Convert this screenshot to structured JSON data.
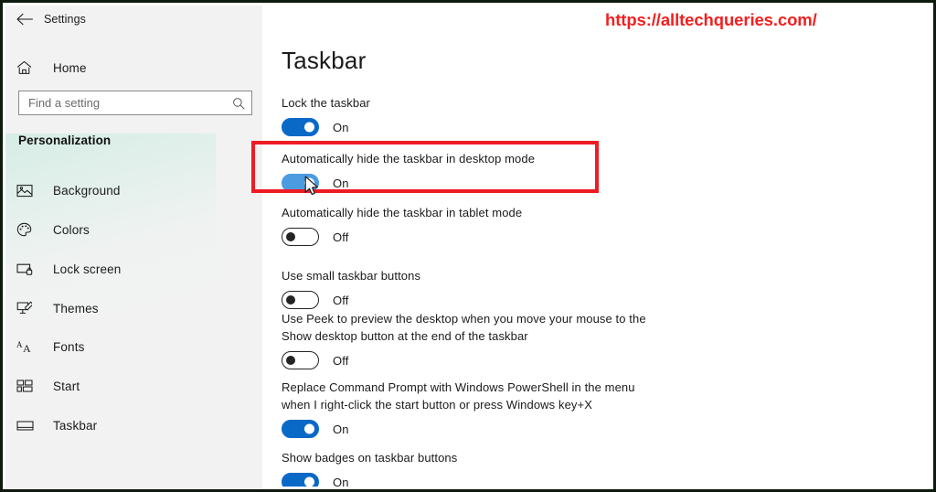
{
  "window": {
    "back_label": "back-arrow",
    "title": "Settings"
  },
  "sidebar": {
    "home": {
      "label": "Home",
      "icon": "home-icon"
    },
    "search": {
      "value": "",
      "placeholder": "Find a setting",
      "icon": "search-icon"
    },
    "section_heading": "Personalization",
    "items": [
      {
        "label": "Background",
        "icon": "image-icon"
      },
      {
        "label": "Colors",
        "icon": "palette-icon"
      },
      {
        "label": "Lock screen",
        "icon": "lock-screen-icon"
      },
      {
        "label": "Themes",
        "icon": "themes-brush-icon"
      },
      {
        "label": "Fonts",
        "icon": "fonts-icon"
      },
      {
        "label": "Start",
        "icon": "start-tiles-icon"
      },
      {
        "label": "Taskbar",
        "icon": "taskbar-icon"
      }
    ]
  },
  "content": {
    "watermark": "https://alltechqueries.com/",
    "page_title": "Taskbar",
    "settings": [
      {
        "label": "Lock the taskbar",
        "state": "On",
        "on": true,
        "hover": false,
        "highlighted": false
      },
      {
        "label": "Automatically hide the taskbar in desktop mode",
        "state": "On",
        "on": true,
        "hover": true,
        "highlighted": true
      },
      {
        "label": "Automatically hide the taskbar in tablet mode",
        "state": "Off",
        "on": false,
        "hover": false,
        "highlighted": false
      },
      {
        "label": "Use small taskbar buttons",
        "state": "Off",
        "on": false,
        "hover": false,
        "highlighted": false
      },
      {
        "label": "Use Peek to preview the desktop when you move your mouse to the\nShow desktop button at the end of the taskbar",
        "state": "Off",
        "on": false,
        "hover": false,
        "highlighted": false
      },
      {
        "label": "Replace Command Prompt with Windows PowerShell in the menu\nwhen I right-click the start button or press Windows key+X",
        "state": "On",
        "on": true,
        "hover": false,
        "highlighted": false
      },
      {
        "label": "Show badges on taskbar buttons",
        "state": "On",
        "on": true,
        "hover": false,
        "highlighted": false
      }
    ]
  },
  "annotation": {
    "highlight_color": "#ed1c24",
    "watermark_color": "#f22020",
    "accent_on_color": "#0a69c7",
    "accent_hover_color": "#4b9be0"
  }
}
